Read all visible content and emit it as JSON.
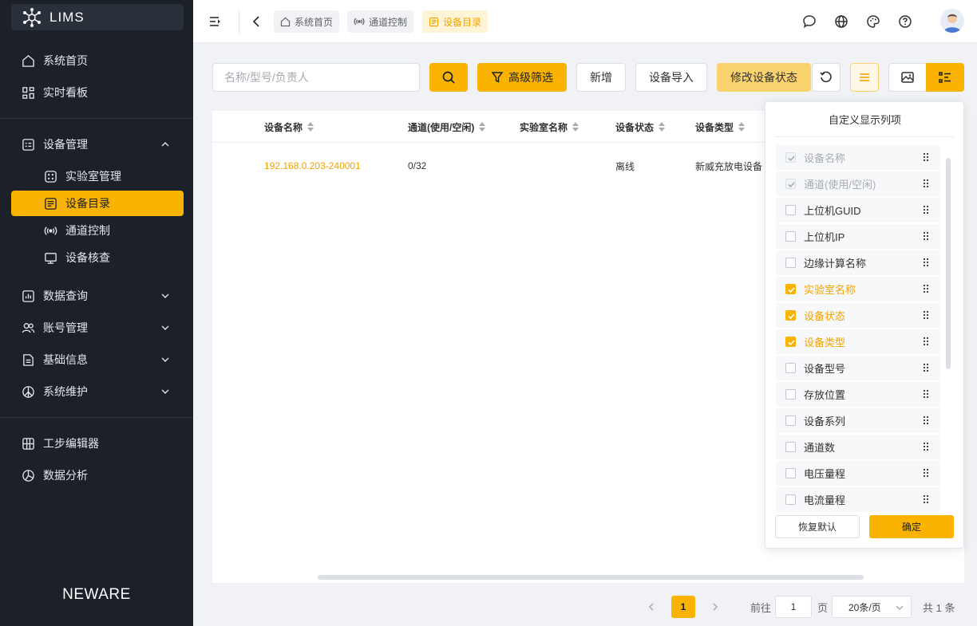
{
  "app": {
    "logo_text": "LIMS",
    "brand": "NEWARE"
  },
  "sidebar": {
    "items": [
      {
        "label": "系统首页",
        "icon": "home-icon"
      },
      {
        "label": "实时看板",
        "icon": "dashboard-icon"
      },
      {
        "label": "设备管理",
        "icon": "device-manage-icon",
        "expanded": true
      },
      {
        "label": "实验室管理",
        "icon": "lab-icon"
      },
      {
        "label": "设备目录",
        "icon": "catalog-icon",
        "active": true
      },
      {
        "label": "通道控制",
        "icon": "signal-icon"
      },
      {
        "label": "设备核查",
        "icon": "monitor-icon"
      },
      {
        "label": "数据查询",
        "icon": "chart-icon"
      },
      {
        "label": "账号管理",
        "icon": "users-icon"
      },
      {
        "label": "基础信息",
        "icon": "document-icon"
      },
      {
        "label": "系统维护",
        "icon": "peace-icon"
      },
      {
        "label": "工步编辑器",
        "icon": "grid-icon"
      },
      {
        "label": "数据分析",
        "icon": "pie-icon"
      }
    ]
  },
  "header": {
    "breadcrumbs": [
      {
        "label": "系统首页",
        "icon": "home-icon"
      },
      {
        "label": "通道控制",
        "icon": "signal-icon"
      },
      {
        "label": "设备目录",
        "icon": "catalog-icon",
        "active": true
      }
    ],
    "icons": [
      "chat-icon",
      "globe-icon",
      "palette-icon",
      "help-icon"
    ]
  },
  "toolbar": {
    "search_placeholder": "名称/型号/负责人",
    "advanced_filter": "高级筛选",
    "add": "新增",
    "import": "设备导入",
    "modify_status": "修改设备状态"
  },
  "table": {
    "columns": [
      "设备名称",
      "通道(使用/空闲)",
      "实验室名称",
      "设备状态",
      "设备类型"
    ],
    "rows": [
      {
        "name": "192.168.0.203-240001",
        "channels": "0/32",
        "lab": "",
        "status": "离线",
        "type": "新威充放电设备"
      }
    ]
  },
  "column_picker": {
    "title": "自定义显示列项",
    "items": [
      {
        "label": "设备名称",
        "state": "disabled"
      },
      {
        "label": "通道(使用/空闲)",
        "state": "disabled"
      },
      {
        "label": "上位机GUID",
        "state": "off"
      },
      {
        "label": "上位机IP",
        "state": "off"
      },
      {
        "label": "边缘计算名称",
        "state": "off"
      },
      {
        "label": "实验室名称",
        "state": "on"
      },
      {
        "label": "设备状态",
        "state": "on"
      },
      {
        "label": "设备类型",
        "state": "on"
      },
      {
        "label": "设备型号",
        "state": "off"
      },
      {
        "label": "存放位置",
        "state": "off"
      },
      {
        "label": "设备系列",
        "state": "off"
      },
      {
        "label": "通道数",
        "state": "off"
      },
      {
        "label": "电压量程",
        "state": "off"
      },
      {
        "label": "电流量程",
        "state": "off"
      }
    ],
    "reset": "恢复默认",
    "confirm": "确定"
  },
  "pagination": {
    "current": "1",
    "goto_label": "前往",
    "page_value": "1",
    "page_unit": "页",
    "page_size": "20条/页",
    "total": "共 1 条"
  },
  "colors": {
    "accent": "#f9b300",
    "sidebar_bg": "#1b2029",
    "link": "#f4a300"
  }
}
